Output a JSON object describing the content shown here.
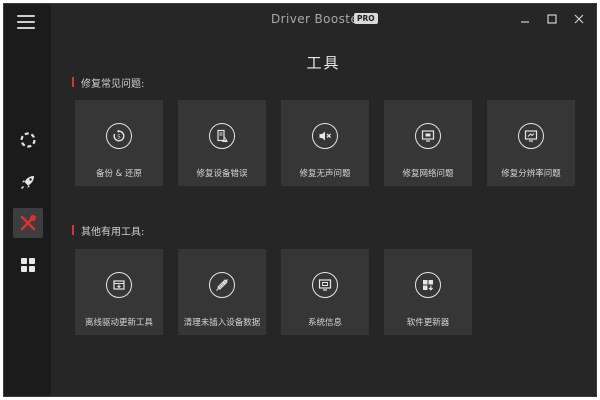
{
  "window": {
    "app_name": "Driver Booster 8",
    "badge": "PRO"
  },
  "sidebar": {
    "items": [
      {
        "icon": "lifebuoy-icon",
        "active": false
      },
      {
        "icon": "rocket-icon",
        "active": false
      },
      {
        "icon": "tools-icon",
        "active": true
      },
      {
        "icon": "grid-icon",
        "active": false
      }
    ]
  },
  "main": {
    "title": "工具",
    "sections": [
      {
        "label": "修复常见问题:",
        "tiles": [
          {
            "label": "备份 & 还原",
            "icon": "restore-icon"
          },
          {
            "label": "修复设备错误",
            "icon": "device-error-icon"
          },
          {
            "label": "修复无声问题",
            "icon": "mute-icon"
          },
          {
            "label": "修复网络问题",
            "icon": "network-icon"
          },
          {
            "label": "修复分辨率问题",
            "icon": "resolution-icon"
          }
        ]
      },
      {
        "label": "其他有用工具:",
        "tiles": [
          {
            "label": "离线驱动更新工具",
            "icon": "offline-update-icon"
          },
          {
            "label": "清理未插入设备数据",
            "icon": "clean-device-icon"
          },
          {
            "label": "系统信息",
            "icon": "system-info-icon"
          },
          {
            "label": "软件更新器",
            "icon": "software-updater-icon"
          }
        ]
      }
    ]
  },
  "colors": {
    "accent": "#e0302e",
    "tile_bg": "#363636",
    "window_bg": "#262626",
    "sidebar_bg": "#1b1b1b"
  }
}
